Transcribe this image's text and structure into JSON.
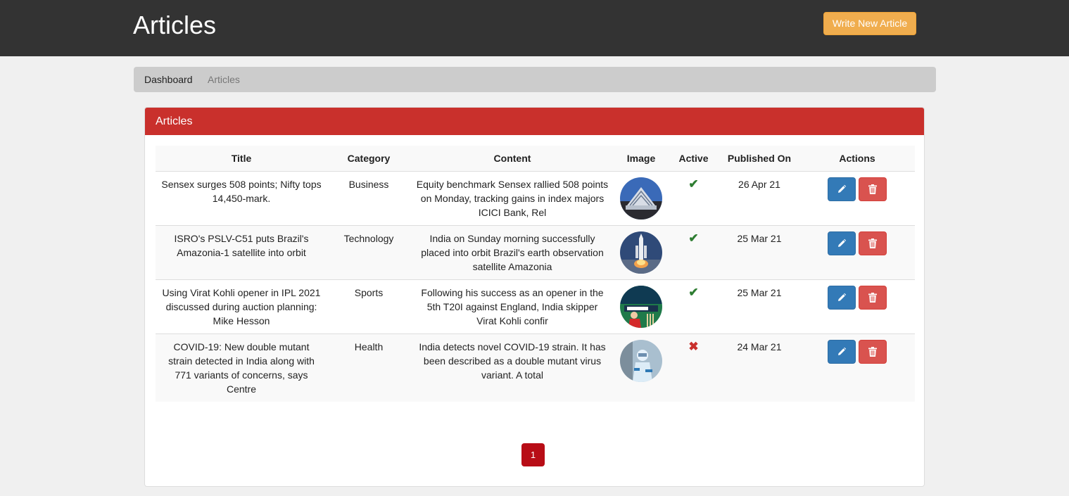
{
  "header": {
    "title": "Articles",
    "write_button": "Write New Article"
  },
  "breadcrumb": {
    "items": [
      "Dashboard",
      "Articles"
    ]
  },
  "panel": {
    "title": "Articles"
  },
  "table": {
    "columns": [
      "Title",
      "Category",
      "Content",
      "Image",
      "Active",
      "Published On",
      "Actions"
    ],
    "rows": [
      {
        "title": "Sensex surges 508 points; Nifty tops 14,450-mark.",
        "category": "Business",
        "content": "Equity benchmark Sensex rallied 508 points on Monday, tracking gains in index majors ICICI Bank, Rel",
        "image": "stock-exchange-building",
        "active": "✔",
        "published": "26 Apr 21"
      },
      {
        "title": "ISRO's PSLV-C51 puts Brazil's Amazonia-1 satellite into orbit",
        "category": "Technology",
        "content": "India on Sunday morning successfully placed into orbit Brazil's earth observation satellite Amazonia",
        "image": "rocket-launch",
        "active": "✔",
        "published": "25 Mar 21"
      },
      {
        "title": "Using Virat Kohli opener in IPL 2021 discussed during auction planning: Mike Hesson",
        "category": "Sports",
        "content": "Following his success as an opener in the 5th T20I against England, India skipper Virat Kohli confir",
        "image": "cricket-player",
        "active": "✔",
        "published": "25 Mar 21"
      },
      {
        "title": "COVID-19: New double mutant strain detected in India along with 771 variants of concerns, says Centre",
        "category": "Health",
        "content": "India detects novel COVID-19 strain. It has been described as a double mutant virus variant. A total",
        "image": "lab-worker",
        "active": "✖",
        "published": "24 Mar 21"
      }
    ]
  },
  "pagination": {
    "current": "1"
  },
  "colors": {
    "topbar": "#333333",
    "panel_header": "#c9302c",
    "write_button": "#f0ad4e",
    "edit": "#337ab7",
    "delete": "#d9534f",
    "pager": "#b80d16"
  },
  "icons": {
    "edit": "pencil-icon",
    "delete": "trash-icon",
    "active": "check-icon",
    "inactive": "x-icon"
  }
}
